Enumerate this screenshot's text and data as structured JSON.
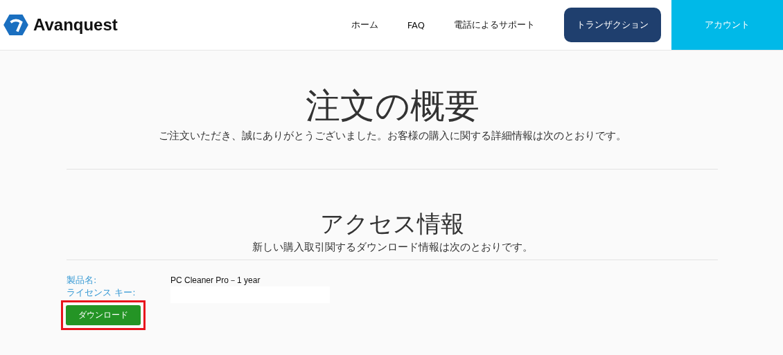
{
  "header": {
    "logo_text": "Avanquest",
    "nav": [
      {
        "label": "ホーム",
        "selected": false
      },
      {
        "label": "FAQ",
        "selected": false
      },
      {
        "label": "電話によるサポート",
        "selected": false
      },
      {
        "label": "トランザクション",
        "selected": true
      }
    ],
    "account": "アカウント"
  },
  "summary": {
    "title": "注文の概要",
    "text": "ご注文いただき、誠にありがとうございました。お客様の購入に関する詳細情報は次のとおりです。"
  },
  "access": {
    "title": "アクセス情報",
    "text": "新しい購入取引関するダウンロード情報は次のとおりです。",
    "fields": [
      {
        "label": "製品名:",
        "value": "PC Cleaner Pro－1 year"
      },
      {
        "label": "ライセンス キー:"
      }
    ],
    "download_button": "ダウンロード",
    "highlighted": true
  }
}
